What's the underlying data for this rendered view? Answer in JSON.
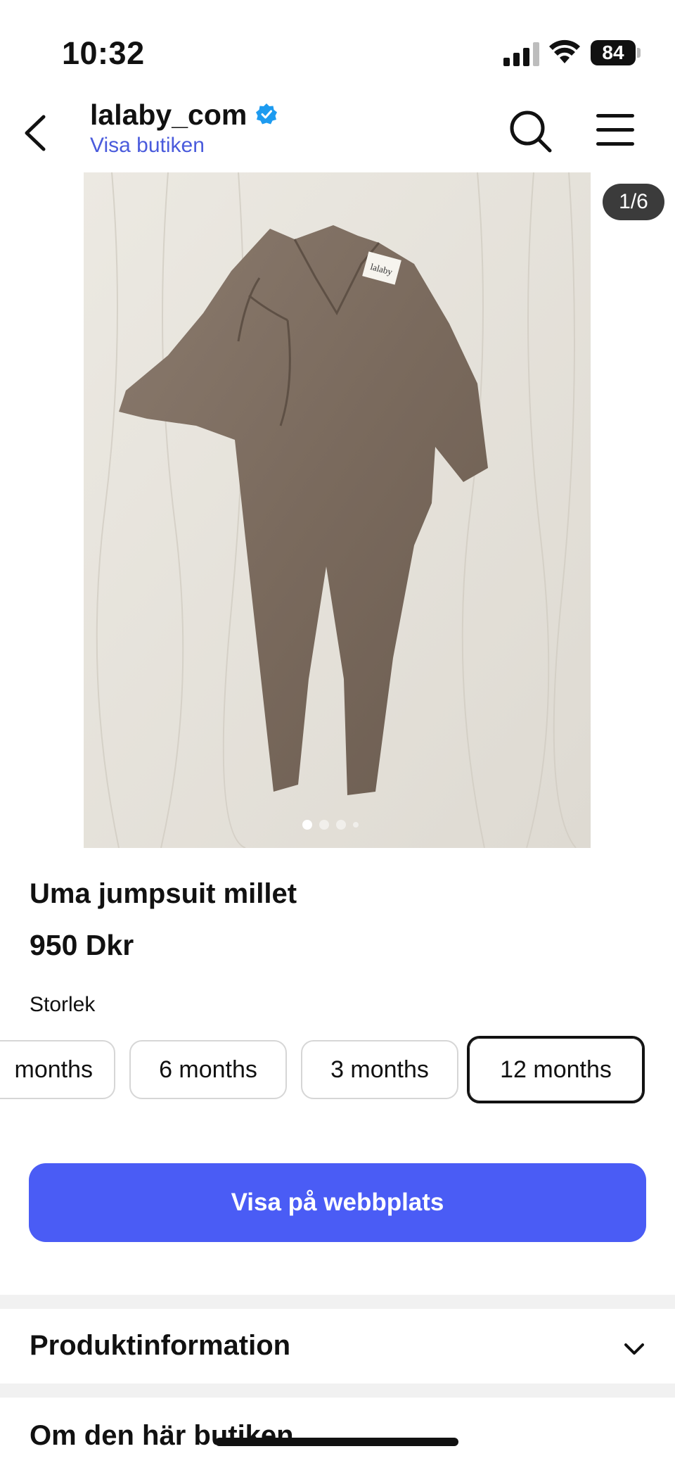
{
  "status_bar": {
    "time": "10:32",
    "battery": "84"
  },
  "header": {
    "shop_name": "lalaby_com",
    "shop_link": "Visa butiken"
  },
  "gallery": {
    "counter": "1/6",
    "label_text": "lalaby"
  },
  "product": {
    "title": "Uma jumpsuit millet",
    "price": "950 Dkr",
    "size_label": "Storlek",
    "sizes": [
      {
        "label": "months",
        "selected": false
      },
      {
        "label": "6 months",
        "selected": false
      },
      {
        "label": "3 months",
        "selected": false
      },
      {
        "label": "12 months",
        "selected": true
      }
    ],
    "cta": "Visa på webbplats"
  },
  "sections": {
    "product_info": "Produktinformation",
    "about_shop": "Om den här butiken"
  },
  "colors": {
    "accent": "#4a5cf5",
    "link": "#4a5bdc",
    "verified": "#1d9bf0"
  }
}
